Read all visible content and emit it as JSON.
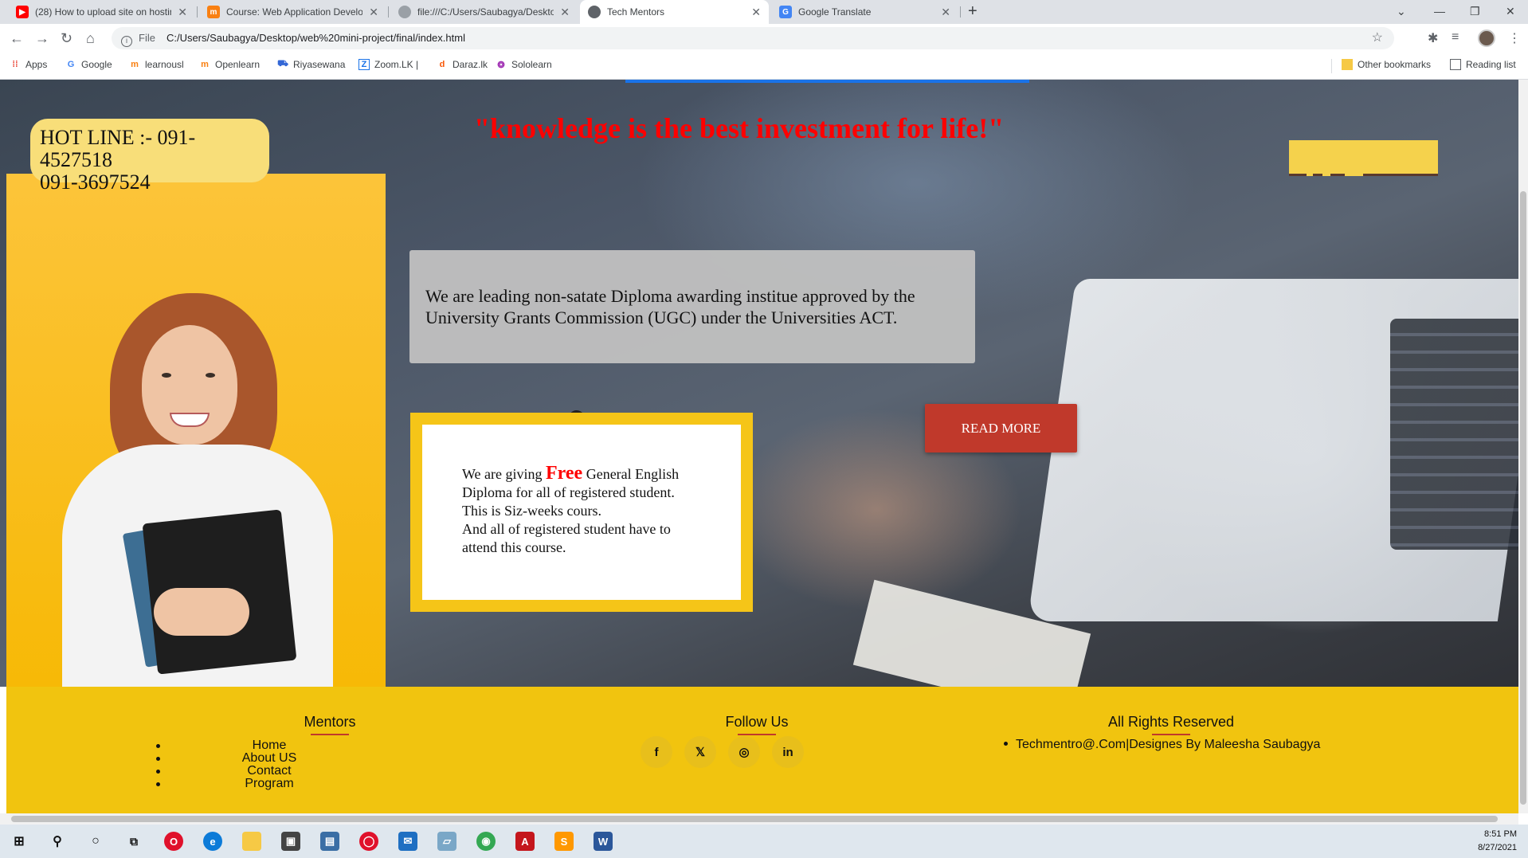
{
  "browser": {
    "tabs": [
      {
        "title": "(28) How to upload site on hostin",
        "icon": "youtube-icon",
        "color": "#ff0000"
      },
      {
        "title": "Course: Web Application Develop",
        "icon": "moodle-icon",
        "color": "#f98012"
      },
      {
        "title": "file:///C:/Users/Saubagya/Deskto",
        "icon": "globe-icon",
        "color": "#5f6368"
      },
      {
        "title": "Tech Mentors",
        "icon": "globe-icon",
        "color": "#5f6368"
      },
      {
        "title": "Google Translate",
        "icon": "translate-icon",
        "color": "#4285f4"
      }
    ],
    "address": {
      "scheme_label": "File",
      "url": "C:/Users/Saubagya/Desktop/web%20mini-project/final/index.html"
    },
    "bookmarks": [
      {
        "label": "Apps",
        "icon": "apps-icon"
      },
      {
        "label": "Google",
        "icon": "google-icon"
      },
      {
        "label": "learnousl",
        "icon": "moodle-icon"
      },
      {
        "label": "Openlearn",
        "icon": "moodle-icon"
      },
      {
        "label": "Riyasewana",
        "icon": "car-icon"
      },
      {
        "label": "Zoom.LK |",
        "icon": "zoom-icon"
      },
      {
        "label": "Daraz.lk",
        "icon": "daraz-icon"
      },
      {
        "label": "Sololearn",
        "icon": "sololearn-icon"
      }
    ],
    "other_bookmarks": "Other bookmarks",
    "reading_list": "Reading list"
  },
  "page": {
    "quote": "\"knowledge is the best investment for life!\"",
    "hotline": {
      "line1": "HOT LINE :- 091-4527518",
      "line2": "091-3697524"
    },
    "intro": "We are leading non-satate Diploma awarding institue approved by the University Grants Commission (UGC) under the Universities ACT.",
    "read_more": "READ MORE",
    "free_course": {
      "prefix": "We are giving ",
      "highlight": "Free",
      "rest": " General English Diploma for all of registered student.",
      "line2": "This is Siz-weeks cours.",
      "line3": "And all of registered student have to attend this course."
    }
  },
  "footer": {
    "mentors_title": "Mentors",
    "links": [
      "Home",
      "About US",
      "Contact",
      "Program"
    ],
    "follow_title": "Follow Us",
    "socials": [
      {
        "glyph": "f",
        "icon": "facebook-icon"
      },
      {
        "glyph": "𝕏",
        "icon": "twitter-icon"
      },
      {
        "glyph": "◎",
        "icon": "instagram-icon"
      },
      {
        "glyph": "in",
        "icon": "linkedin-icon"
      }
    ],
    "rights_title": "All Rights Reserved",
    "rights_text": "Techmentro@.Com|Designes By Maleesha Saubagya"
  },
  "taskbar": {
    "time": "8:51 PM",
    "date": "8/27/2021"
  },
  "colors": {
    "accent_yellow": "#f1c40f",
    "quote_red": "#ff0000",
    "button_red": "#c0392b"
  }
}
